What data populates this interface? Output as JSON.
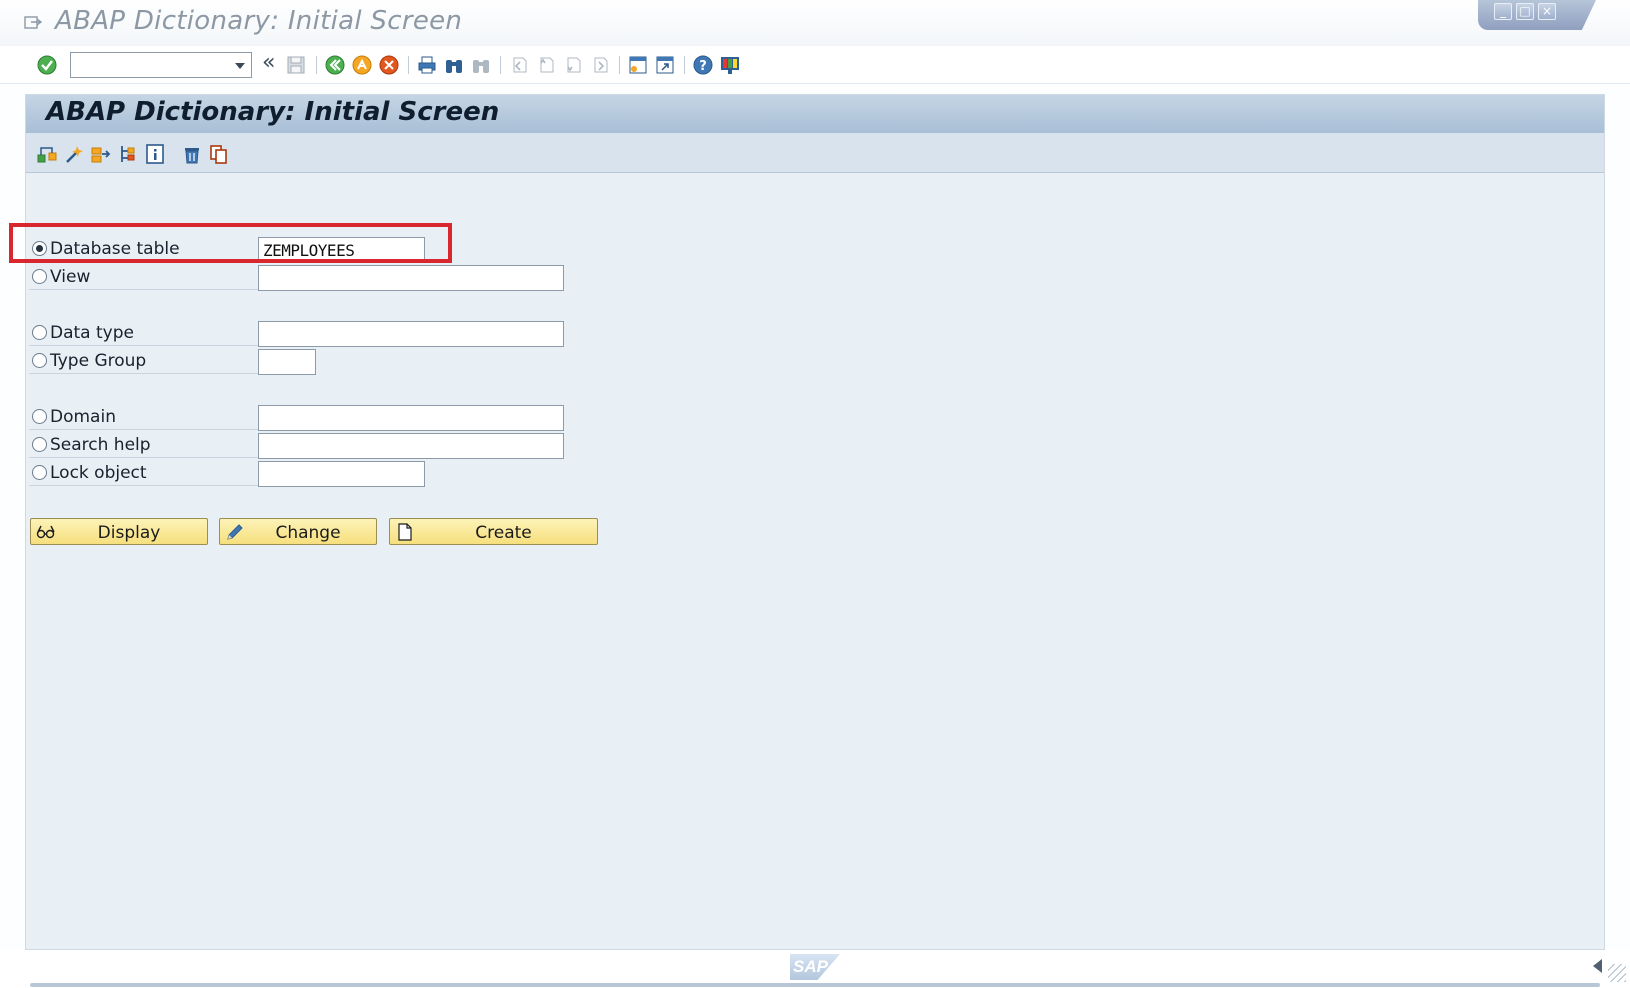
{
  "window": {
    "title": "ABAP Dictionary: Initial Screen",
    "controls": [
      "minimize",
      "maximize",
      "close"
    ]
  },
  "toolbar": {
    "command_field_value": "",
    "collapse_symbol": "«",
    "icons": [
      "enter-icon",
      "save-icon",
      "back-icon",
      "exit-icon",
      "cancel-icon",
      "print-icon",
      "find-icon",
      "find-next-icon",
      "first-page-icon",
      "previous-page-icon",
      "next-page-icon",
      "last-page-icon",
      "new-session-icon",
      "shortcut-icon",
      "help-icon",
      "customize-layout-icon"
    ]
  },
  "screen": {
    "title": "ABAP Dictionary: Initial Screen",
    "app_toolbar_icons": [
      "other-object-icon",
      "check-icon",
      "activate-icon",
      "where-used-icon",
      "info-icon",
      "delete-icon",
      "copy-icon"
    ]
  },
  "form": {
    "options": [
      {
        "label": "Database table",
        "value": "ZEMPLOYEES",
        "selected": true
      },
      {
        "label": "View",
        "value": "",
        "selected": false
      },
      {
        "label": "Data type",
        "value": "",
        "selected": false
      },
      {
        "label": "Type Group",
        "value": "",
        "selected": false
      },
      {
        "label": "Domain",
        "value": "",
        "selected": false
      },
      {
        "label": "Search help",
        "value": "",
        "selected": false
      },
      {
        "label": "Lock object",
        "value": "",
        "selected": false
      }
    ]
  },
  "buttons": {
    "display": "Display",
    "change": "Change",
    "create": "Create"
  },
  "statusbar": {
    "logo_text": "SAP"
  },
  "colors": {
    "highlight_box": "#d8272f",
    "button_fill": "#f6df7d",
    "panel_background": "#e8eff5",
    "header_background": "#a8bfd6"
  }
}
